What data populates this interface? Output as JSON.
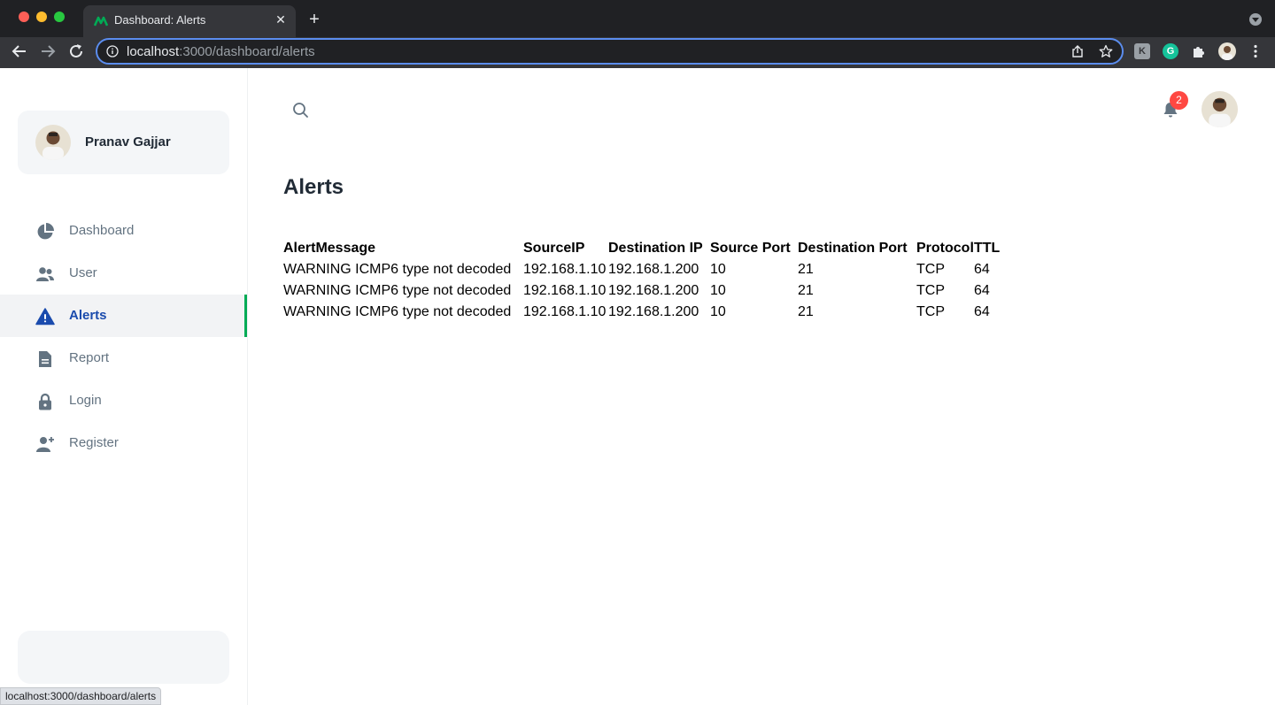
{
  "browser": {
    "tab_title": "Dashboard: Alerts",
    "tab_close": "✕",
    "new_tab": "+",
    "url_host": "localhost",
    "url_path": ":3000/dashboard/alerts",
    "ext_k_label": "K",
    "ext_g_label": "G",
    "status_url": "localhost:3000/dashboard/alerts"
  },
  "sidebar": {
    "account_name": "Pranav Gajjar",
    "items": [
      {
        "label": "Dashboard",
        "icon": "pie-chart-icon",
        "active": false
      },
      {
        "label": "User",
        "icon": "people-icon",
        "active": false
      },
      {
        "label": "Alerts",
        "icon": "alert-triangle-icon",
        "active": true
      },
      {
        "label": "Report",
        "icon": "file-text-icon",
        "active": false
      },
      {
        "label": "Login",
        "icon": "lock-icon",
        "active": false
      },
      {
        "label": "Register",
        "icon": "person-add-icon",
        "active": false
      }
    ]
  },
  "header": {
    "notification_count": "2"
  },
  "main": {
    "title": "Alerts",
    "table": {
      "columns": [
        "AlertMessage",
        "SourceIP",
        "Destination IP",
        "Source Port",
        "Destination Port",
        "Protocol",
        "TTL"
      ],
      "rows": [
        [
          "WARNING ICMP6 type not decoded",
          "192.168.1.10",
          "192.168.1.200",
          "10",
          "21",
          "TCP",
          "64"
        ],
        [
          "WARNING ICMP6 type not decoded",
          "192.168.1.10",
          "192.168.1.200",
          "10",
          "21",
          "TCP",
          "64"
        ],
        [
          "WARNING ICMP6 type not decoded",
          "192.168.1.10",
          "192.168.1.200",
          "10",
          "21",
          "TCP",
          "64"
        ]
      ]
    }
  },
  "colors": {
    "accent_active": "#1a4bad",
    "active_indicator": "#00ab55",
    "badge": "#ff4842"
  }
}
